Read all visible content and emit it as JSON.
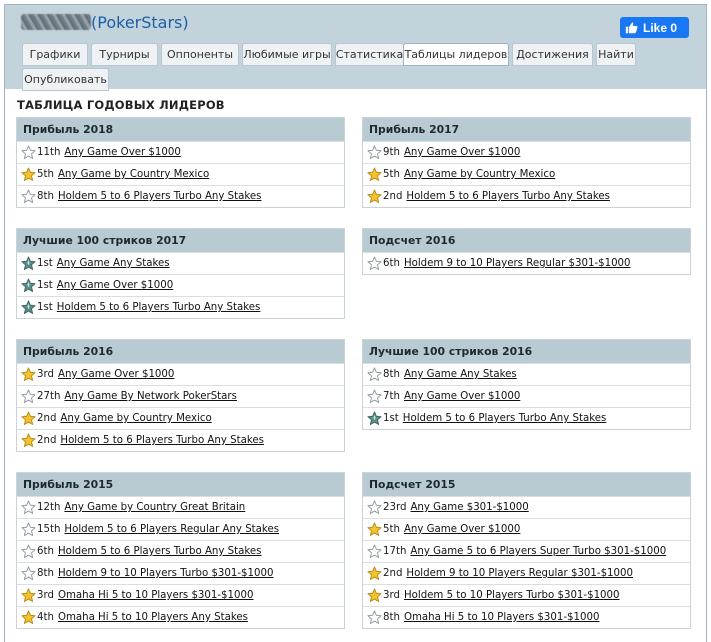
{
  "header": {
    "player_name_hidden": "",
    "paren_open": "(",
    "site": "PokerStars",
    "paren_close": ")"
  },
  "like_button": {
    "label": "Like 0"
  },
  "tabs": [
    {
      "label": "Графики"
    },
    {
      "label": "Турниры"
    },
    {
      "label": "Оппоненты"
    },
    {
      "label": "Любимые игры"
    },
    {
      "label": "Статистика"
    },
    {
      "label": "Таблицы лидеров",
      "active": true
    },
    {
      "label": "Достижения"
    },
    {
      "label": "Найти"
    },
    {
      "label": "Опубликовать"
    }
  ],
  "section_title": "ТАБЛИЦА ГОДОВЫХ ЛИДЕРОВ",
  "cards": [
    {
      "title": "Прибыль 2018",
      "rows": [
        {
          "icon": "silver",
          "place": "11th",
          "link": "Any Game Over $1000"
        },
        {
          "icon": "gold",
          "place": "5th",
          "link": "Any Game by Country Mexico"
        },
        {
          "icon": "silver",
          "place": "8th",
          "link": "Holdem 5 to 6 Players Turbo Any Stakes"
        }
      ]
    },
    {
      "title": "Прибыль 2017",
      "rows": [
        {
          "icon": "silver",
          "place": "9th",
          "link": "Any Game Over $1000"
        },
        {
          "icon": "gold",
          "place": "5th",
          "link": "Any Game by Country Mexico"
        },
        {
          "icon": "gold",
          "place": "2nd",
          "link": "Holdem 5 to 6 Players Turbo Any Stakes"
        }
      ]
    },
    {
      "title": "Лучшие 100 стриков 2017",
      "rows": [
        {
          "icon": "teal",
          "place": "1st",
          "link": "Any Game Any Stakes"
        },
        {
          "icon": "teal",
          "place": "1st",
          "link": "Any Game Over $1000"
        },
        {
          "icon": "teal",
          "place": "1st",
          "link": "Holdem 5 to 6 Players Turbo Any Stakes"
        }
      ]
    },
    {
      "title": "Подсчет 2016",
      "rows": [
        {
          "icon": "silver",
          "place": "6th",
          "link": "Holdem 9 to 10 Players Regular $301-$1000"
        }
      ]
    },
    {
      "title": "Прибыль 2016",
      "rows": [
        {
          "icon": "gold",
          "place": "3rd",
          "link": "Any Game Over $1000"
        },
        {
          "icon": "silver",
          "place": "27th",
          "link": "Any Game By Network PokerStars"
        },
        {
          "icon": "gold",
          "place": "2nd",
          "link": "Any Game by Country Mexico"
        },
        {
          "icon": "gold",
          "place": "2nd",
          "link": "Holdem 5 to 6 Players Turbo Any Stakes"
        }
      ]
    },
    {
      "title": "Лучшие 100 стриков 2016",
      "rows": [
        {
          "icon": "silver",
          "place": "8th",
          "link": "Any Game Any Stakes"
        },
        {
          "icon": "silver",
          "place": "7th",
          "link": "Any Game Over $1000"
        },
        {
          "icon": "teal",
          "place": "1st",
          "link": "Holdem 5 to 6 Players Turbo Any Stakes"
        }
      ]
    },
    {
      "title": "Прибыль 2015",
      "rows": [
        {
          "icon": "silver",
          "place": "12th",
          "link": "Any Game by Country Great Britain"
        },
        {
          "icon": "silver",
          "place": "15th",
          "link": "Holdem 5 to 6 Players Regular Any Stakes"
        },
        {
          "icon": "silver",
          "place": "6th",
          "link": "Holdem 5 to 6 Players Turbo Any Stakes"
        },
        {
          "icon": "silver",
          "place": "8th",
          "link": "Holdem 9 to 10 Players Turbo $301-$1000"
        },
        {
          "icon": "gold",
          "place": "3rd",
          "link": "Omaha Hi 5 to 10 Players $301-$1000"
        },
        {
          "icon": "gold",
          "place": "4th",
          "link": "Omaha Hi 5 to 10 Players Any Stakes"
        }
      ]
    },
    {
      "title": "Подсчет 2015",
      "rows": [
        {
          "icon": "silver",
          "place": "23rd",
          "link": "Any Game $301-$1000"
        },
        {
          "icon": "gold",
          "place": "5th",
          "link": "Any Game Over $1000"
        },
        {
          "icon": "silver",
          "place": "17th",
          "link": "Any Game 5 to 6 Players Super Turbo $301-$1000"
        },
        {
          "icon": "gold",
          "place": "2nd",
          "link": "Holdem 9 to 10 Players Regular $301-$1000"
        },
        {
          "icon": "gold",
          "place": "3rd",
          "link": "Holdem 5 to 10 Players Turbo $301-$1000"
        },
        {
          "icon": "silver",
          "place": "8th",
          "link": "Omaha Hi 5 to 10 Players $301-$1000"
        }
      ]
    }
  ],
  "colors": {
    "header_bg": "#c2d3db",
    "card_head_bg": "#b8cbd3",
    "brand_link": "#1b5fa7",
    "like_blue": "#1877f2",
    "star_gold": "#f2c230",
    "star_silver": "#c8cdd2",
    "star_teal": "#5d8f8a"
  }
}
